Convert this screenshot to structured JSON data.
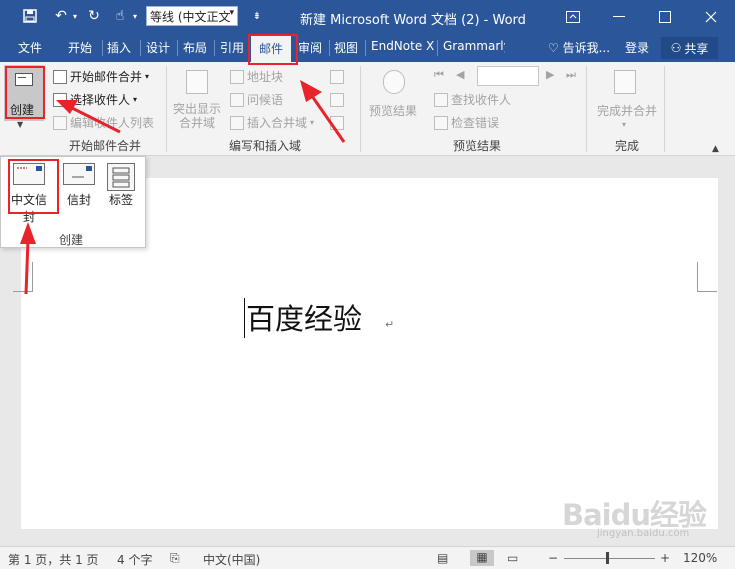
{
  "colors": {
    "title_bar": "#2b579a",
    "highlight": "#e8232a"
  },
  "quick_access": {
    "font_value": "等线 (中文正文",
    "customize_icon": "customize-icon"
  },
  "title": "新建 Microsoft Word 文档 (2) - Word",
  "window_icons": [
    "ribbon-display-icon",
    "minimize-icon",
    "maximize-icon",
    "close-icon"
  ],
  "tabs": [
    "文件",
    "开始",
    "插入",
    "设计",
    "布局",
    "引用",
    "邮件",
    "审阅",
    "视图",
    "EndNote X",
    "Grammarly"
  ],
  "tell_me": "告诉我...",
  "login": "登录",
  "share": "共享",
  "ribbon": {
    "start_merge": {
      "create": "创建",
      "start_mail_merge": "开始邮件合并",
      "select_recipients": "选择收件人",
      "edit_recipients": "编辑收件人列表",
      "group_label": "开始邮件合并"
    },
    "write_insert": {
      "highlight_fields": "突出显示合并域",
      "address_block": "地址块",
      "greeting_line": "问候语",
      "insert_merge_field": "插入合并域",
      "group_label": "编写和插入域"
    },
    "preview": {
      "preview_results": "预览结果",
      "find_recipient": "查找收件人",
      "check_errors": "检查错误",
      "group_label": "预览结果"
    },
    "finish": {
      "finish_merge": "完成并合并",
      "group_label": "完成"
    }
  },
  "dropdown": {
    "items": [
      "中文信封",
      "信封",
      "标签"
    ],
    "label": "创建"
  },
  "document": {
    "text": "百度经验"
  },
  "status": {
    "page": "第 1 页，共 1 页",
    "words": "4 个字",
    "language": "中文(中国)",
    "zoom": "120%"
  },
  "watermark": {
    "brand": "Baidu经验",
    "url": "jingyan.baidu.com"
  }
}
